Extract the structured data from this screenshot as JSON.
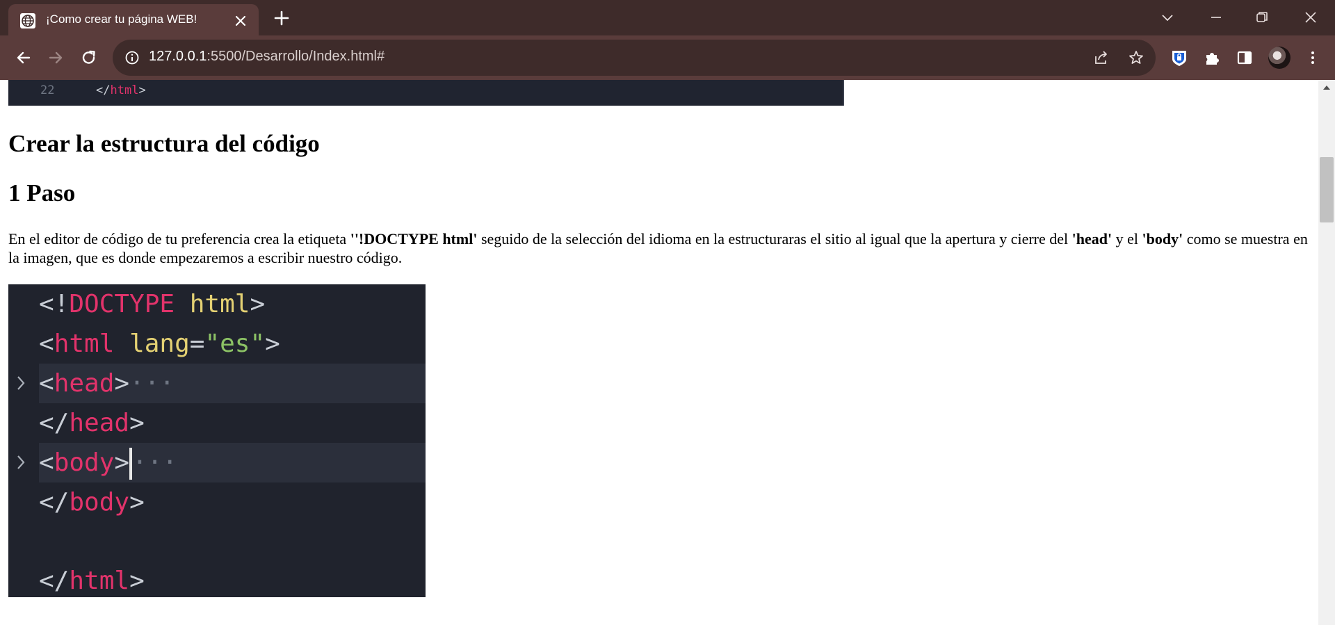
{
  "browser": {
    "tab_title": "¡Como crear tu página WEB!",
    "url_host": "127.0.0.1",
    "url_rest": ":5500/Desarrollo/Index.html#",
    "icons": [
      "globe-icon",
      "close-icon",
      "plus-icon",
      "chevron-down-icon",
      "minimize-icon",
      "restore-icon",
      "window-close-icon",
      "back-icon",
      "forward-icon",
      "reload-icon",
      "info-icon",
      "share-icon",
      "star-icon",
      "shield-extension-icon",
      "puzzle-icon",
      "sidepanel-icon",
      "avatar",
      "more-icon"
    ]
  },
  "page": {
    "code_top": {
      "line_number": "22",
      "tag_open": "</",
      "tag_name": "html",
      "tag_close": ">"
    },
    "heading1": "Crear la estructura del código",
    "heading2": "1 Paso",
    "paragraph": {
      "t1": "En el editor de código de tu preferencia crea la etiqueta ",
      "b1": "''!DOCTYPE html'",
      "t2": " seguido de la selección del idioma en la estructuraras el sitio al igual que la apertura y cierre del ",
      "b2": "'head'",
      "t3": " y el ",
      "b3": "'body'",
      "t4": " como se muestra en la imagen, que es donde empezaremos a escribir nuestro código."
    },
    "code_image": {
      "l1": {
        "a": "<!",
        "b": "DOCTYPE",
        "c": " html",
        "d": ">"
      },
      "l2": {
        "a": "<",
        "b": "html",
        "c": " lang",
        "d": "=",
        "e": "\"es\"",
        "f": ">"
      },
      "l3": {
        "a": "<",
        "b": "head",
        "c": ">",
        "d": "···"
      },
      "l4": {
        "a": "</",
        "b": "head",
        "c": ">"
      },
      "l5": {
        "a": "<",
        "b": "body",
        "c": ">",
        "d": "···"
      },
      "l6": {
        "a": "</",
        "b": "body",
        "c": ">"
      },
      "l8": {
        "a": "</",
        "b": "html",
        "c": ">"
      }
    }
  },
  "colors": {
    "chrome_dark": "#3e2b2a",
    "chrome_tab": "#5a3c3b",
    "code_bg": "#20232d",
    "code_tag": "#e2336b",
    "code_attr": "#e4d173",
    "code_string": "#8cc265"
  }
}
